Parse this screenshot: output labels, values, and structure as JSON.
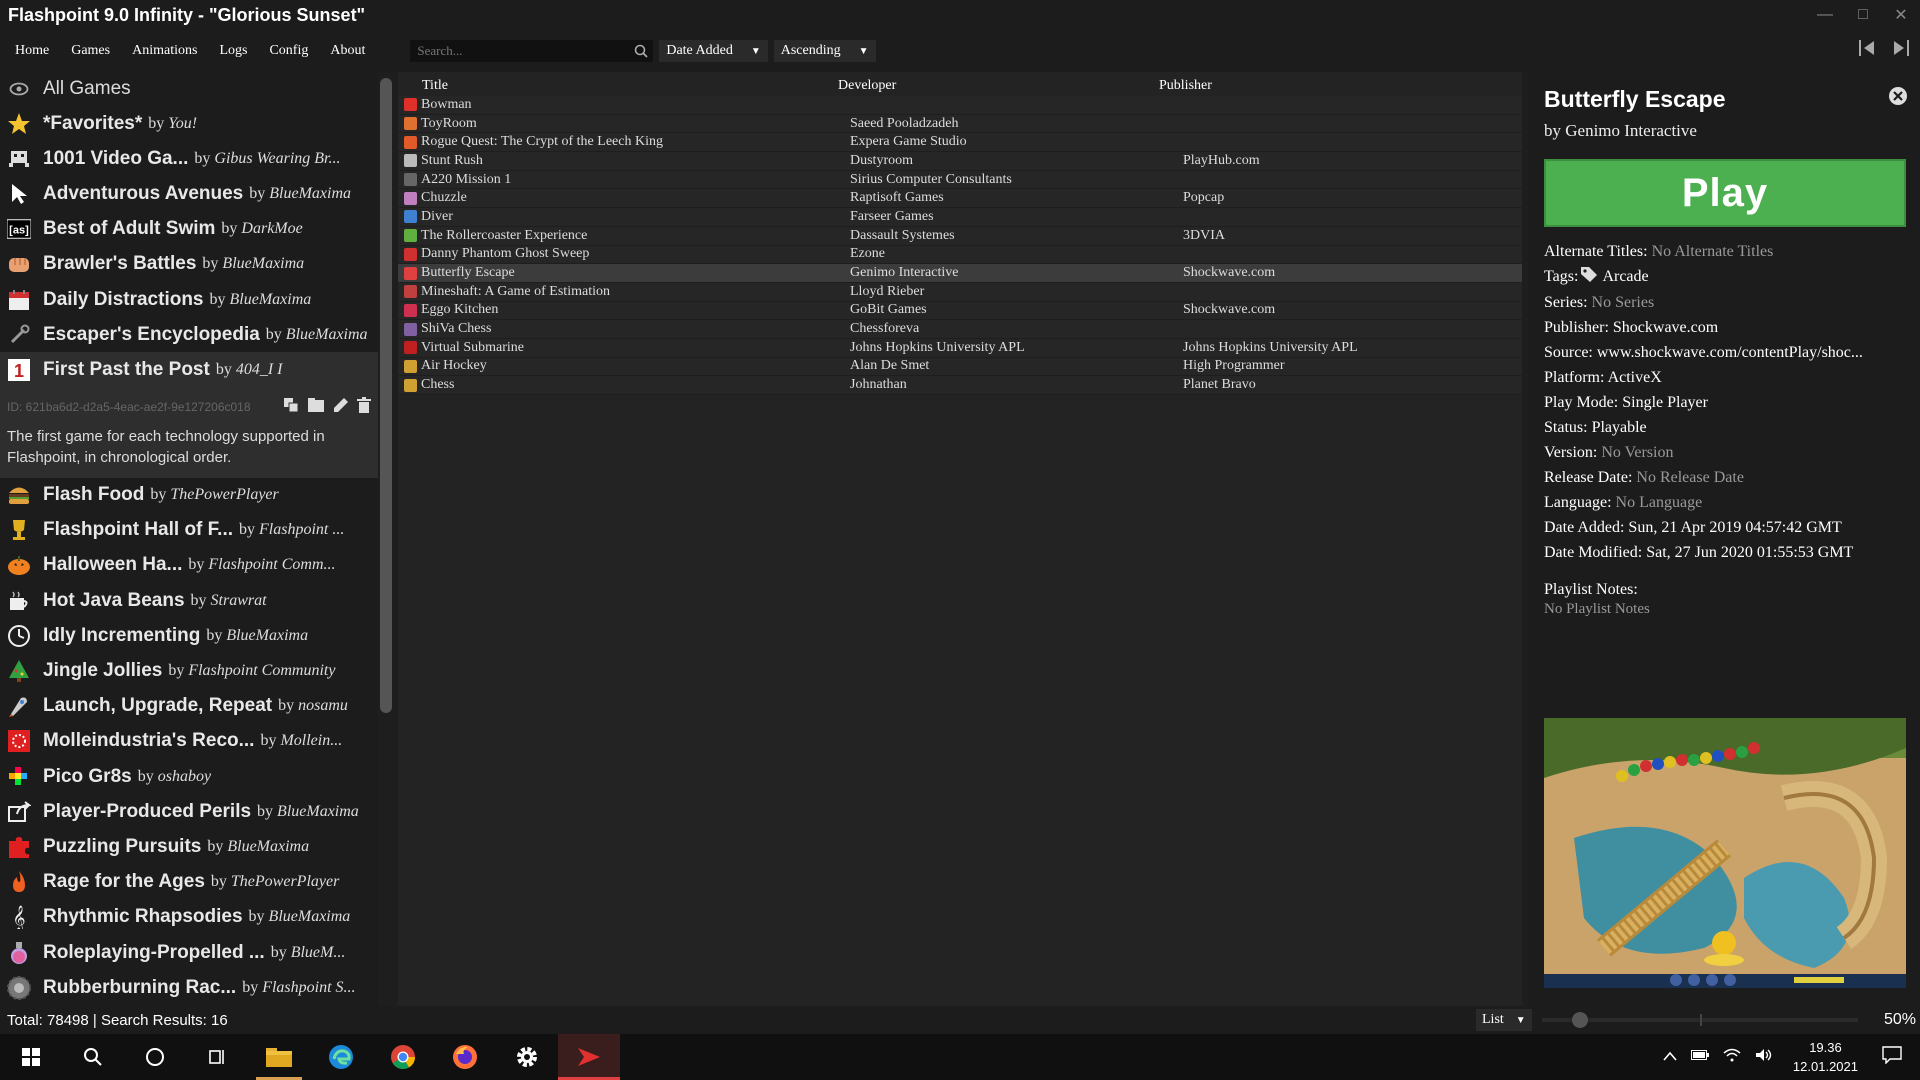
{
  "window": {
    "title": "Flashpoint 9.0 Infinity - \"Glorious Sunset\""
  },
  "menu": {
    "items": [
      "Home",
      "Games",
      "Animations",
      "Logs",
      "Config",
      "About"
    ],
    "search_placeholder": "Search...",
    "sort_by": "Date Added",
    "sort_order": "Ascending"
  },
  "sidebar": {
    "all_games": "All Games",
    "selected_id": "ID: 621ba6d2-d2a5-4eac-ae2f-9e127206c018",
    "selected_description": "The first game for each technology supported in Flashpoint, in chronological order.",
    "playlists_top": [
      {
        "title": "*Favorites*",
        "by": "You!",
        "icon": "star-icon"
      },
      {
        "title": "1001 Video Ga...",
        "by": "Gibus Wearing Br...",
        "icon": "invader-icon"
      },
      {
        "title": "Adventurous Avenues",
        "by": "BlueMaxima",
        "icon": "cursor-icon"
      },
      {
        "title": "Best of Adult Swim",
        "by": "DarkMoe",
        "icon": "adultswim-icon"
      },
      {
        "title": "Brawler's Battles",
        "by": "BlueMaxima",
        "icon": "fist-icon"
      },
      {
        "title": "Daily Distractions",
        "by": "BlueMaxima",
        "icon": "calendar-icon"
      },
      {
        "title": "Escaper's Encyclopedia",
        "by": "BlueMaxima",
        "icon": "wrench-icon"
      },
      {
        "title": "First Past the Post",
        "by": "404_I I",
        "icon": "first-place-icon"
      }
    ],
    "playlists_bottom": [
      {
        "title": "Flash Food",
        "by": "ThePowerPlayer",
        "icon": "burger-icon"
      },
      {
        "title": "Flashpoint Hall of F...",
        "by": "Flashpoint ...",
        "icon": "trophy-icon"
      },
      {
        "title": "Halloween Ha...",
        "by": "Flashpoint Comm...",
        "icon": "pumpkin-icon"
      },
      {
        "title": "Hot Java Beans",
        "by": "Strawrat",
        "icon": "coffee-icon"
      },
      {
        "title": "Idly Incrementing",
        "by": "BlueMaxima",
        "icon": "clock-icon"
      },
      {
        "title": "Jingle Jollies",
        "by": "Flashpoint Community",
        "icon": "tree-icon"
      },
      {
        "title": "Launch, Upgrade, Repeat",
        "by": "nosamu",
        "icon": "rocket-icon"
      },
      {
        "title": "Molleindustria's Reco...",
        "by": "Mollein...",
        "icon": "molleindustria-icon"
      },
      {
        "title": "Pico Gr8s",
        "by": "oshaboy",
        "icon": "pico-icon"
      },
      {
        "title": "Player-Produced Perils",
        "by": "BlueMaxima",
        "icon": "share-icon"
      },
      {
        "title": "Puzzling Pursuits",
        "by": "BlueMaxima",
        "icon": "puzzle-icon"
      },
      {
        "title": "Rage for the Ages",
        "by": "ThePowerPlayer",
        "icon": "flame-icon"
      },
      {
        "title": "Rhythmic Rhapsodies",
        "by": "BlueMaxima",
        "icon": "treble-clef-icon"
      },
      {
        "title": "Roleplaying-Propelled ...",
        "by": "BlueM...",
        "icon": "potion-icon"
      },
      {
        "title": "Rubberburning Rac...",
        "by": "Flashpoint S...",
        "icon": "tire-icon"
      }
    ],
    "by_label": "by"
  },
  "gamelist": {
    "columns": [
      "Title",
      "Developer",
      "Publisher"
    ],
    "rows": [
      {
        "title": "Bowman",
        "developer": "",
        "publisher": "",
        "icon": "flash-icon",
        "color": "#e0302a"
      },
      {
        "title": "ToyRoom",
        "developer": "Saeed Pooladzadeh",
        "publisher": "",
        "icon": "java-icon",
        "color": "#e07030"
      },
      {
        "title": "Rogue Quest: The Crypt of the Leech King",
        "developer": "Expera Game Studio",
        "publisher": "",
        "icon": "html5-icon",
        "color": "#e05a2a"
      },
      {
        "title": "Stunt Rush",
        "developer": "Dustyroom",
        "publisher": "PlayHub.com",
        "icon": "unity-icon",
        "color": "#bbbbbb"
      },
      {
        "title": "A220 Mission 1",
        "developer": "Sirius Computer Consultants",
        "publisher": "",
        "icon": "vrml-icon",
        "color": "#666666"
      },
      {
        "title": "Chuzzle",
        "developer": "Raptisoft Games",
        "publisher": "Popcap",
        "icon": "popcap-icon",
        "color": "#c080c0"
      },
      {
        "title": "Diver",
        "developer": "Farseer Games",
        "publisher": "",
        "icon": "silverlight-icon",
        "color": "#4080d0"
      },
      {
        "title": "The Rollercoaster Experience",
        "developer": "Dassault Systemes",
        "publisher": "3DVIA",
        "icon": "3dvia-icon",
        "color": "#60b040"
      },
      {
        "title": "Danny Phantom Ghost Sweep",
        "developer": "Ezone",
        "publisher": "",
        "icon": "shockwave-icon",
        "color": "#d03030"
      },
      {
        "title": "Butterfly Escape",
        "developer": "Genimo Interactive",
        "publisher": "Shockwave.com",
        "icon": "activex-icon",
        "color": "#e04040"
      },
      {
        "title": "Mineshaft: A Game of Estimation",
        "developer": "Lloyd Rieber",
        "publisher": "",
        "icon": "authorware-icon",
        "color": "#c04040"
      },
      {
        "title": "Eggo Kitchen",
        "developer": "GoBit Games",
        "publisher": "Shockwave.com",
        "icon": "goBit-icon",
        "color": "#d03050"
      },
      {
        "title": "ShiVa Chess",
        "developer": "Chessforeva",
        "publisher": "",
        "icon": "shiva-icon",
        "color": "#8060a0"
      },
      {
        "title": "Virtual Submarine",
        "developer": "Johns Hopkins University APL",
        "publisher": "Johns Hopkins University APL",
        "icon": "cult3d-icon",
        "color": "#c02020"
      },
      {
        "title": "Air Hockey",
        "developer": "Alan De Smet",
        "publisher": "High Programmer",
        "icon": "arrow-icon",
        "color": "#d0a030"
      },
      {
        "title": "Chess",
        "developer": "Johnathan",
        "publisher": "Planet Bravo",
        "icon": "puppy-icon",
        "color": "#d0a030"
      }
    ],
    "selected_index": 9
  },
  "details": {
    "title": "Butterfly Escape",
    "by": "by Genimo Interactive",
    "play_label": "Play",
    "fields": [
      {
        "key": "Alternate Titles:",
        "value": "No Alternate Titles",
        "dim": true
      },
      {
        "key": "Tags:",
        "value": "Arcade",
        "dim": false,
        "tag": true
      },
      {
        "key": "Series:",
        "value": "No Series",
        "dim": true
      },
      {
        "key": "Publisher:",
        "value": "Shockwave.com",
        "dim": false
      },
      {
        "key": "Source:",
        "value": "www.shockwave.com/contentPlay/shoc...",
        "dim": false
      },
      {
        "key": "Platform:",
        "value": "ActiveX",
        "dim": false
      },
      {
        "key": "Play Mode:",
        "value": "Single Player",
        "dim": false
      },
      {
        "key": "Status:",
        "value": "Playable",
        "dim": false
      },
      {
        "key": "Version:",
        "value": "No Version",
        "dim": true
      },
      {
        "key": "Release Date:",
        "value": "No Release Date",
        "dim": true
      },
      {
        "key": "Language:",
        "value": "No Language",
        "dim": true
      },
      {
        "key": "Date Added:",
        "value": " Sun, 21 Apr 2019 04:57:42 GMT",
        "dim": false
      },
      {
        "key": "Date Modified:",
        "value": " Sat, 27 Jun 2020 01:55:53 GMT",
        "dim": false
      }
    ],
    "playlist_notes_label": "Playlist Notes:",
    "playlist_notes_value": "No Playlist Notes"
  },
  "footer": {
    "totals": "Total: 78498 | Search Results: 16",
    "view_mode": "List",
    "zoom": "50%",
    "zoom_fraction": 0.5
  },
  "taskbar": {
    "time": "19.36",
    "date": "12.01.2021"
  },
  "colors": {
    "play_green": "#4caf50",
    "accent_red": "#e04040"
  }
}
